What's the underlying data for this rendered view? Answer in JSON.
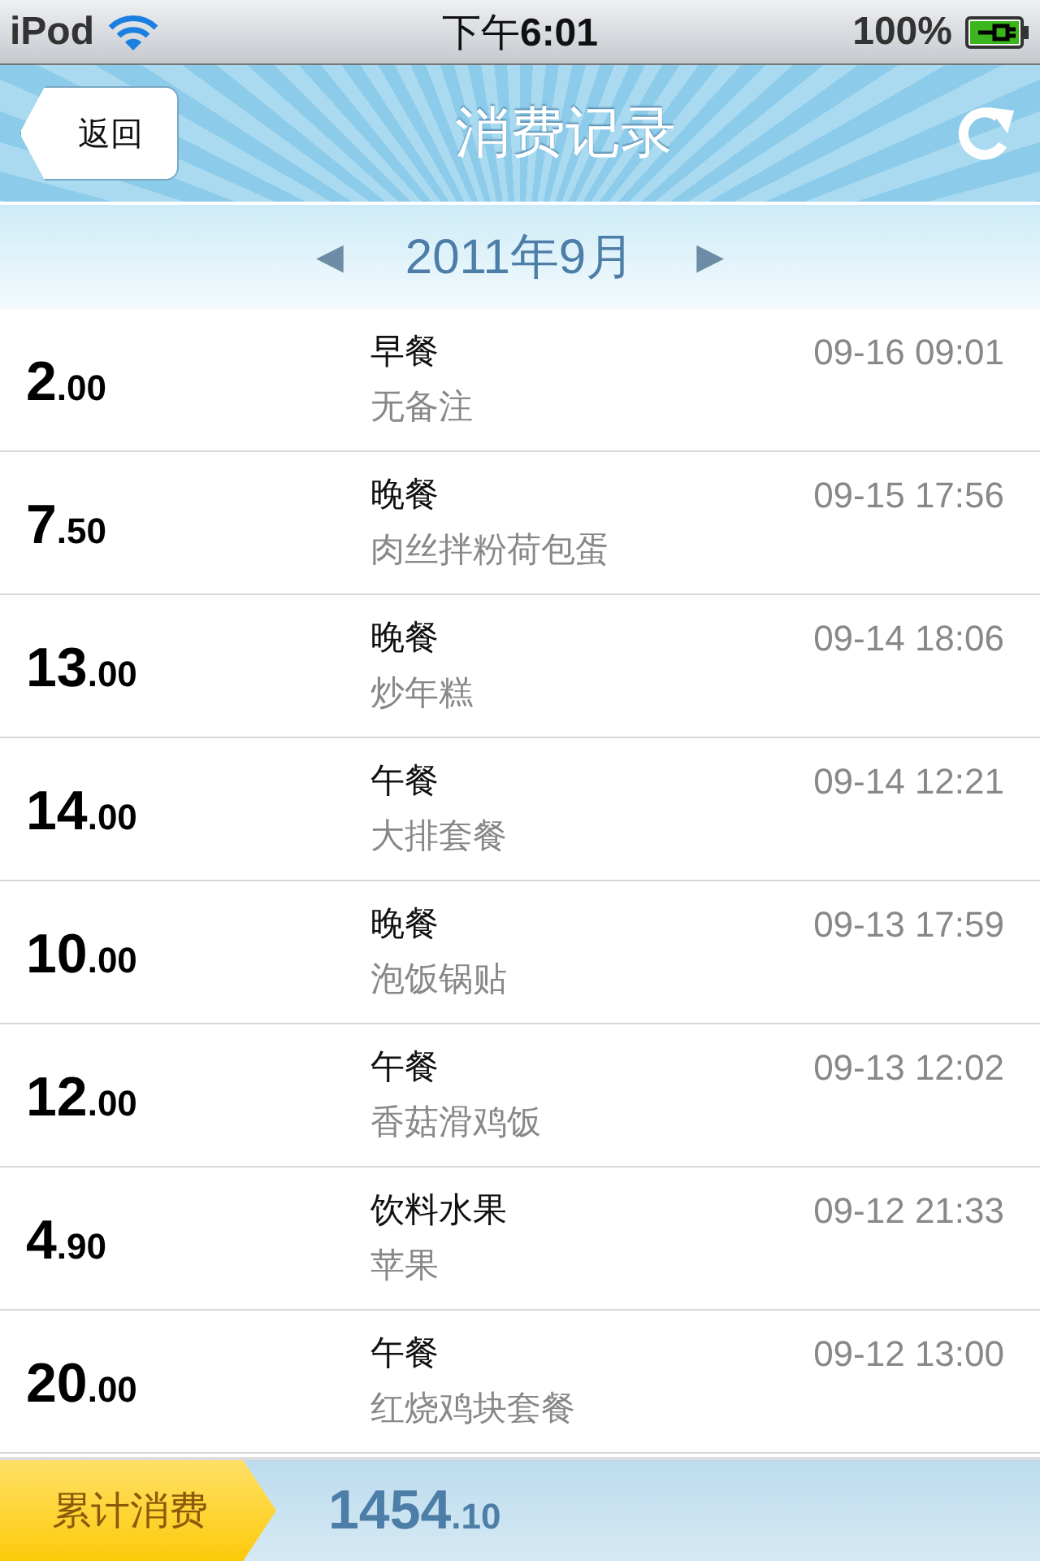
{
  "status_bar": {
    "device": "iPod",
    "time_prefix": "下午",
    "time": "6:01",
    "battery": "100%"
  },
  "nav": {
    "back": "返回",
    "title": "消费记录"
  },
  "month": {
    "label": "2011年9月",
    "prev": "◀",
    "next": "▶"
  },
  "records": [
    {
      "amount": "2",
      "cents": ".00",
      "meal": "早餐",
      "note": "无备注",
      "time": "09-16 09:01"
    },
    {
      "amount": "7",
      "cents": ".50",
      "meal": "晚餐",
      "note": "肉丝拌粉荷包蛋",
      "time": "09-15 17:56"
    },
    {
      "amount": "13",
      "cents": ".00",
      "meal": "晚餐",
      "note": "炒年糕",
      "time": "09-14 18:06"
    },
    {
      "amount": "14",
      "cents": ".00",
      "meal": "午餐",
      "note": "大排套餐",
      "time": "09-14 12:21"
    },
    {
      "amount": "10",
      "cents": ".00",
      "meal": "晚餐",
      "note": "泡饭锅贴",
      "time": "09-13 17:59"
    },
    {
      "amount": "12",
      "cents": ".00",
      "meal": "午餐",
      "note": "香菇滑鸡饭",
      "time": "09-13 12:02"
    },
    {
      "amount": "4",
      "cents": ".90",
      "meal": "饮料水果",
      "note": "苹果",
      "time": "09-12 21:33"
    },
    {
      "amount": "20",
      "cents": ".00",
      "meal": "午餐",
      "note": "红烧鸡块套餐",
      "time": "09-12 13:00"
    }
  ],
  "total": {
    "label": "累计消费",
    "amount": "1454",
    "cents": ".10"
  }
}
